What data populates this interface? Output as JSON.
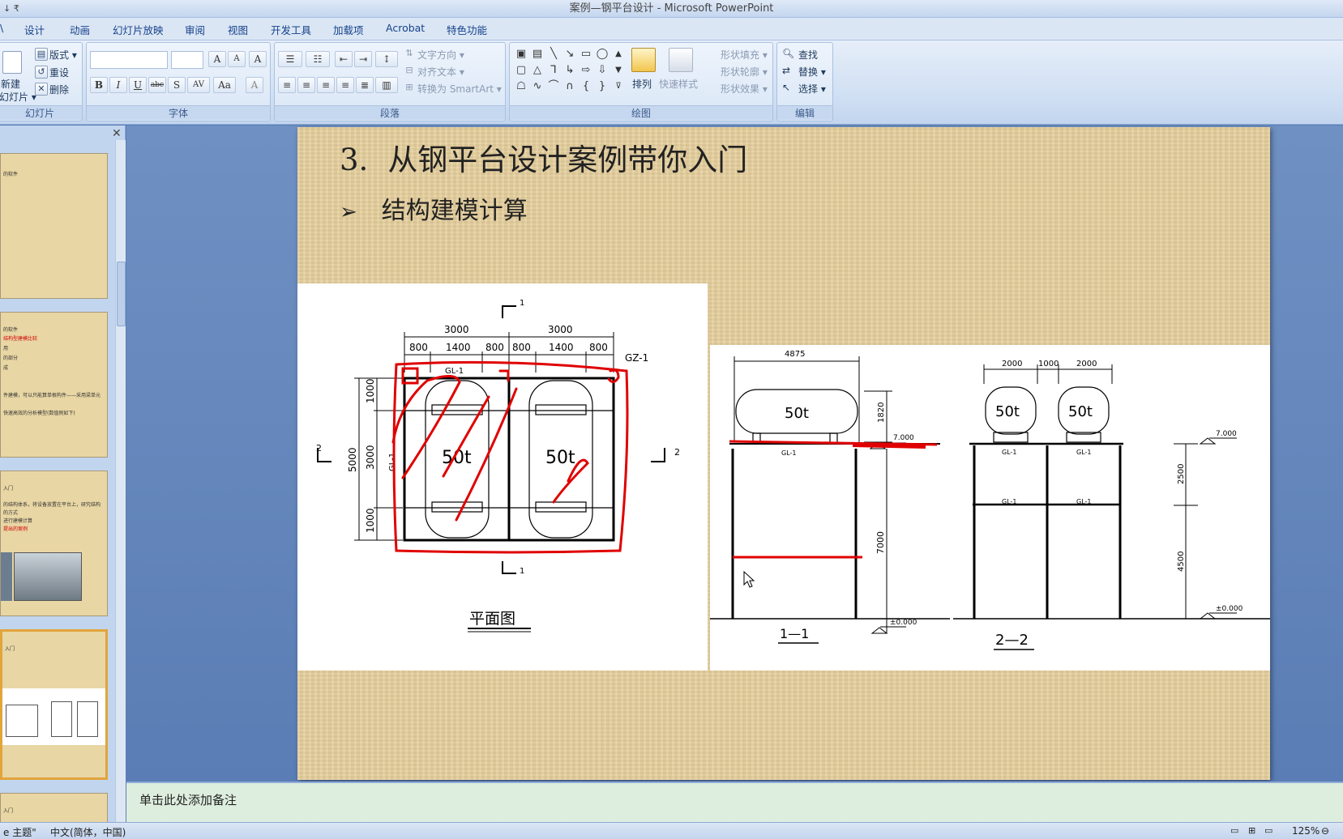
{
  "window": {
    "title": "案例—钢平台设计 - Microsoft PowerPoint",
    "quick_access": "↓ ₹"
  },
  "menu_tabs": [
    "设计",
    "动画",
    "幻灯片放映",
    "审阅",
    "视图",
    "开发工具",
    "加载项",
    "Acrobat",
    "特色功能"
  ],
  "ribbon": {
    "slides_group": {
      "label": "幻灯片",
      "new_slide": "新建",
      "new_slide_sub": "幻灯片 ▾",
      "layout": "版式 ▾",
      "reset": "重设",
      "delete": "删除"
    },
    "font_group": {
      "label": "字体",
      "bold": "B",
      "italic": "I",
      "underline": "U",
      "strike": "abc",
      "shadow": "S",
      "spacing": "AV",
      "case": "Aa",
      "grow": "A",
      "shrink": "A",
      "clear": "A"
    },
    "paragraph_group": {
      "label": "段落",
      "text_direction": "文字方向 ▾",
      "align_text": "对齐文本 ▾",
      "smartart": "转换为 SmartArt ▾"
    },
    "drawing_group": {
      "label": "绘图",
      "arrange": "排列",
      "quick_styles": "快速样式",
      "shape_fill": "形状填充 ▾",
      "shape_outline": "形状轮廓 ▾",
      "shape_effects": "形状效果 ▾"
    },
    "editing_group": {
      "label": "编辑",
      "find": "查找",
      "replace": "替换 ▾",
      "select": "选择 ▾"
    }
  },
  "slide_pane": {
    "close": "✕",
    "thumbs": [
      {
        "lines": [
          "的软件"
        ],
        "red": []
      },
      {
        "lines": [
          "的软件",
          "用",
          "的部分",
          "成",
          "件建模，可以只能算单根构件——采用梁单元",
          "快速高效的分析模型(数值例如下)"
        ],
        "red": [
          "结构型建模比较"
        ]
      },
      {
        "lines": [
          "入门",
          "的结构体系，将设备放置在平台上，研究结构",
          "的方式",
          "进行建模计算"
        ],
        "red": [
          "提出的案例"
        ]
      },
      {
        "lines": [
          "入门"
        ],
        "red": []
      },
      {
        "lines": [
          "入门"
        ],
        "red": []
      }
    ]
  },
  "slide": {
    "title_num": "3.",
    "title": "从钢平台设计案例带你入门",
    "bullet_arrow": "➢",
    "bullet": "结构建模计算",
    "plan": {
      "caption": "平面图",
      "dim_top_total": [
        "3000",
        "3000"
      ],
      "dim_top_parts": [
        "800",
        "1400",
        "800",
        "800",
        "1400",
        "800"
      ],
      "dim_left_total": "5000",
      "dim_left_parts": [
        "1000",
        "3000",
        "1000"
      ],
      "tank_label": "50t",
      "beam_label": "GL-1",
      "column_label": "GZ-1",
      "beam_label_vertical": "GL-1",
      "section_mark_1": "1",
      "section_mark_2": "2"
    },
    "elevation_1": {
      "caption": "1—1",
      "dim_tank": "4875",
      "dim_tank_h": "1820",
      "dim_height": "7000",
      "level_top": "7.000",
      "level_base": "±0.000",
      "tank_label": "50t",
      "beam_label": "GL-1"
    },
    "elevation_2": {
      "caption": "2—2",
      "dims_top": [
        "2000",
        "1000",
        "2000"
      ],
      "dim_upper": "2500",
      "dim_lower": "4500",
      "level_top": "7.000",
      "level_base": "±0.000",
      "tank_label": "50t",
      "beam_label": "GL-1"
    }
  },
  "notes": {
    "placeholder": "单击此处添加备注"
  },
  "status": {
    "theme": "e 主题\"",
    "language": "中文(简体，中国)",
    "zoom": "125%",
    "zoom_out": "⊖"
  },
  "colors": {
    "ribbon_text": "#1e395b",
    "slide_bg": "#e6cf9d",
    "annotation": "#e00000",
    "notes_bg": "#deeede"
  }
}
